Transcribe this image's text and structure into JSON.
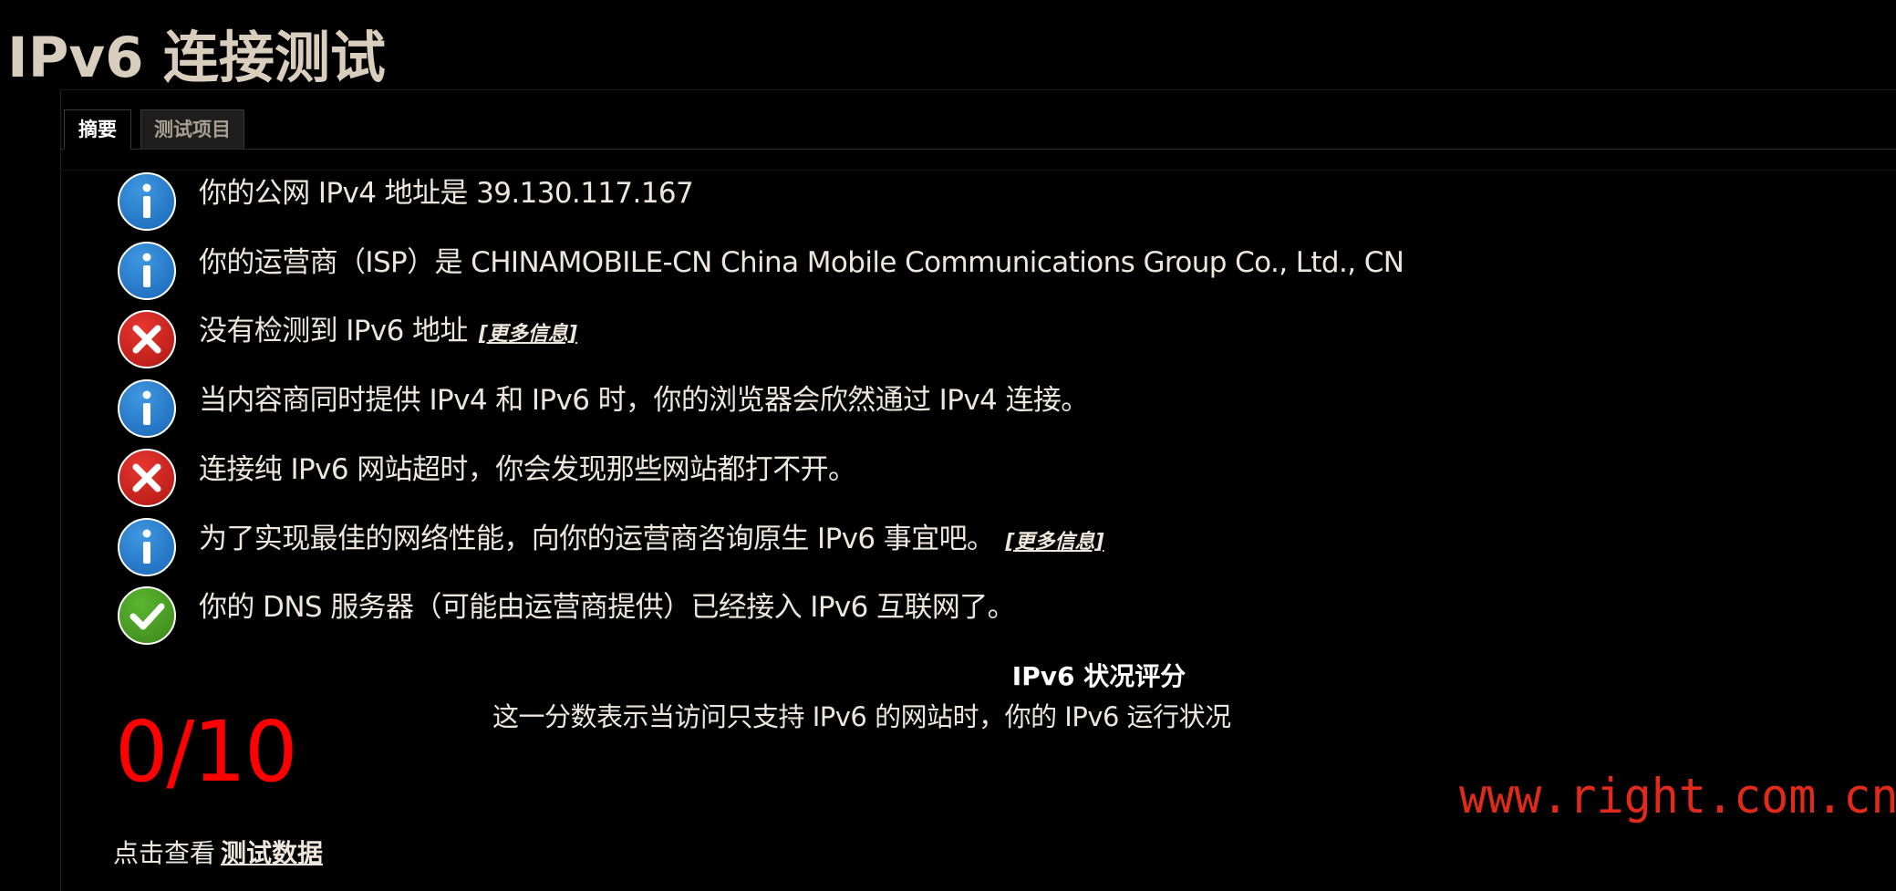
{
  "page": {
    "title": "IPv6 连接测试"
  },
  "tabs": [
    {
      "label": "摘要",
      "active": true
    },
    {
      "label": "测试项目",
      "active": false
    }
  ],
  "results": [
    {
      "status": "info",
      "icon": "info-icon",
      "text": "你的公网 IPv4 地址是 39.130.117.167",
      "link": ""
    },
    {
      "status": "info",
      "icon": "info-icon",
      "text": "你的运营商（ISP）是 CHINAMOBILE-CN China Mobile Communications Group Co., Ltd., CN",
      "link": ""
    },
    {
      "status": "error",
      "icon": "error-x-icon",
      "text": "没有检测到 IPv6 地址",
      "link": "[更多信息]"
    },
    {
      "status": "info",
      "icon": "info-icon",
      "text": "当内容商同时提供 IPv4 和 IPv6 时，你的浏览器会欣然通过 IPv4 连接。",
      "link": ""
    },
    {
      "status": "error",
      "icon": "error-x-icon",
      "text": "连接纯 IPv6 网站超时，你会发现那些网站都打不开。",
      "link": ""
    },
    {
      "status": "info",
      "icon": "info-icon",
      "text": "为了实现最佳的网络性能，向你的运营商咨询原生 IPv6 事宜吧。",
      "link": "[更多信息]"
    },
    {
      "status": "ok",
      "icon": "check-icon",
      "text": "你的 DNS 服务器（可能由运营商提供）已经接入 IPv6 互联网了。",
      "link": ""
    }
  ],
  "rating": {
    "heading": "IPv6 状况评分",
    "description": "这一分数表示当访问只支持 IPv6 的网站时，你的 IPv6 运行状况",
    "score": "0/10"
  },
  "footer": {
    "prefix": "点击查看",
    "link": "测试数据"
  },
  "watermark": "www.right.com.cn",
  "colors": {
    "background": "#000000",
    "title": "#d9cdbd",
    "text": "#ece6dc",
    "score": "#ff0000",
    "watermark": "#e22a1a",
    "info_icon": "#3f97e0",
    "error_icon": "#e8362f",
    "ok_icon": "#5cb530"
  }
}
